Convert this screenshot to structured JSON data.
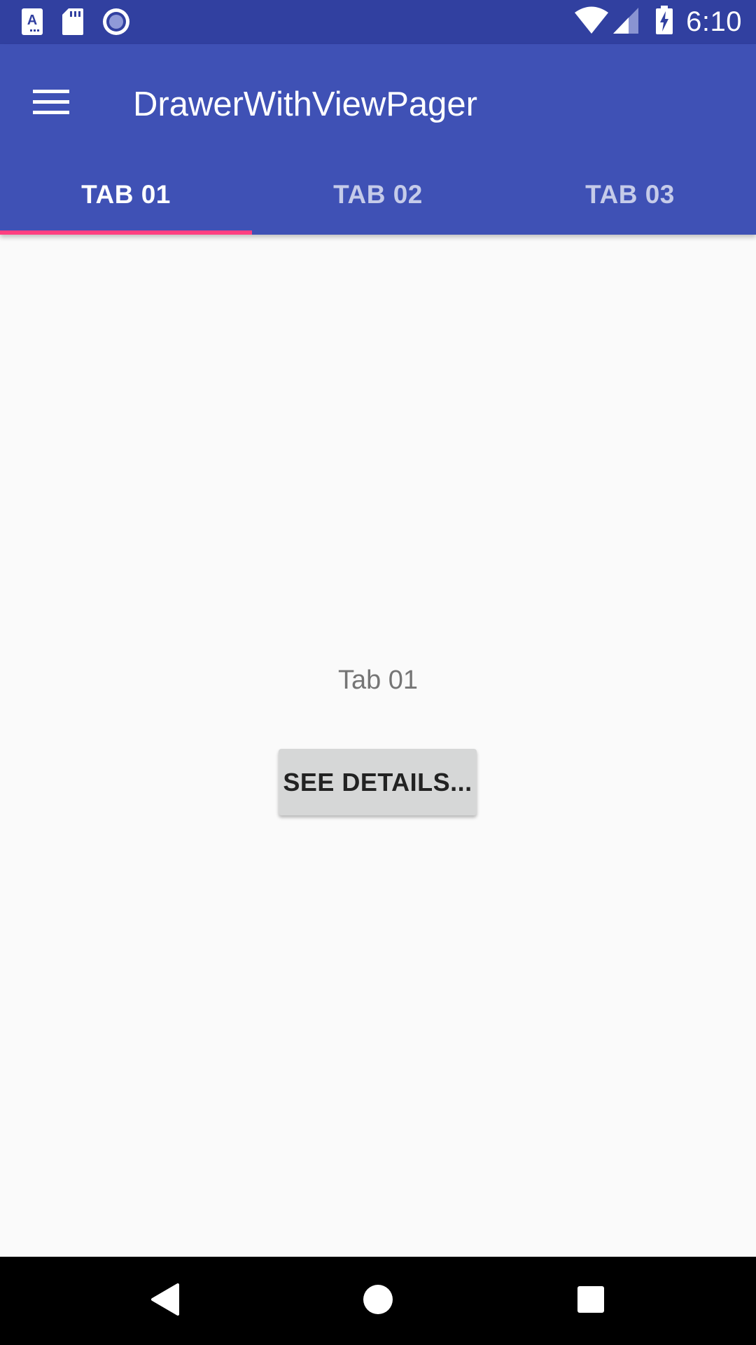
{
  "status_bar": {
    "time": "6:10",
    "icons": [
      "font-icon",
      "sd-card-icon",
      "record-icon",
      "wifi-icon",
      "signal-icon",
      "battery-charging-icon"
    ]
  },
  "app_bar": {
    "title": "DrawerWithViewPager",
    "menu_icon": "hamburger-menu-icon",
    "color": "#3f51b5",
    "status_color": "#3140a0"
  },
  "tabs": [
    {
      "label": "TAB 01",
      "active": true
    },
    {
      "label": "TAB 02",
      "active": false
    },
    {
      "label": "TAB 03",
      "active": false
    }
  ],
  "indicator_color": "#ff4081",
  "content": {
    "label": "Tab 01",
    "button_label": "SEE DETAILS..."
  },
  "nav_bar": {
    "icons": [
      "back-icon",
      "home-icon",
      "recents-icon"
    ]
  }
}
